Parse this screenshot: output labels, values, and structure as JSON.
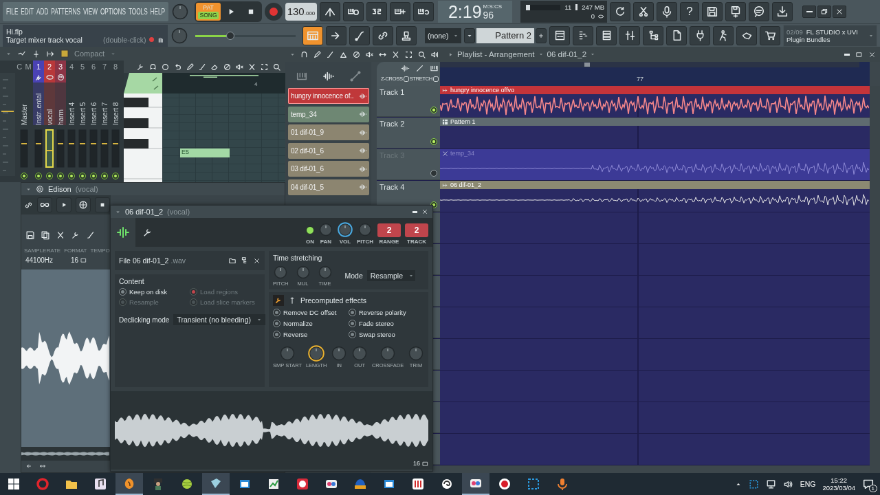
{
  "menu": [
    "FILE",
    "EDIT",
    "ADD",
    "PATTERNS",
    "VIEW",
    "OPTIONS",
    "TOOLS",
    "HELP"
  ],
  "transport": {
    "pat": "PAT",
    "song": "SONG",
    "song_selected": true,
    "record_armed": true,
    "tempo": "130",
    "tempo_decimals": ".000"
  },
  "time": {
    "main": "2:19",
    "unit": "M:S:CS",
    "centis": "96"
  },
  "monitor": {
    "voices": "11",
    "memory": "247 MB",
    "polyphony": "0"
  },
  "help": "?",
  "hint": {
    "file": "Hi.flp",
    "message": "Target mixer track  vocal",
    "action": "(double-click)"
  },
  "master_pitch": {
    "level": 0.35
  },
  "pattern_tools": [
    {
      "on": true
    },
    {
      "on": false
    },
    {
      "on": false
    },
    {
      "on": false
    },
    {
      "on": false
    }
  ],
  "pattern": {
    "picker": "(none)",
    "name": "Pattern 2"
  },
  "news": {
    "counter": "02/09",
    "title": "FL STUDIO x UVI",
    "subtitle": "Plugin Bundles"
  },
  "mixer": {
    "view": "Compact",
    "header": [
      "C",
      "M"
    ],
    "master": "Master",
    "inserts": [
      {
        "number": "1",
        "name": "Instr..ental",
        "color": "#4a42b4",
        "selected": false
      },
      {
        "number": "2",
        "name": "vocal",
        "color": "#b8383a",
        "selected": true
      },
      {
        "number": "3",
        "name": "harm",
        "color": "#8c3446",
        "selected": false
      },
      {
        "number": "4",
        "name": "Insert 4",
        "selected": false
      },
      {
        "number": "5",
        "name": "Insert 5",
        "selected": false
      },
      {
        "number": "6",
        "name": "Insert 6",
        "selected": false
      },
      {
        "number": "7",
        "name": "Insert 7",
        "selected": false
      },
      {
        "number": "8",
        "name": "Insert 8",
        "selected": false
      }
    ]
  },
  "piano_roll": {
    "bar": "4",
    "note": "E5"
  },
  "playlist": {
    "title": "Playlist - Arrangement",
    "clip": "06 dif-01_2",
    "bar": "77",
    "options": [
      {
        "label": "Z-CROSS",
        "checked": false
      },
      {
        "label": "STRETCH",
        "checked": false
      }
    ],
    "picker_tabs": [
      {
        "kind": "pattern",
        "selected": false
      },
      {
        "kind": "audio",
        "selected": true
      },
      {
        "kind": "automation",
        "selected": false
      }
    ],
    "picker_items": [
      {
        "name": "hungry innocence of..",
        "color": "#c0383a",
        "selected": true
      },
      {
        "name": "temp_34",
        "color": "#6e8773",
        "selected": false
      },
      {
        "name": "01 dif-01_9",
        "color": "#8c8570",
        "selected": false
      },
      {
        "name": "02 dif-01_6",
        "color": "#8c8570",
        "selected": false
      },
      {
        "name": "03 dif-01_6",
        "color": "#8c8570",
        "selected": false
      },
      {
        "name": "04 dif-01_5",
        "color": "#8c8570",
        "selected": false
      }
    ],
    "tracks": [
      {
        "name": "Track 1",
        "enabled": true,
        "clip": {
          "name": "hungry innocence offvo",
          "kind": "audio",
          "color": "#c4343a"
        }
      },
      {
        "name": "Track 2",
        "enabled": true,
        "clip": {
          "name": "Pattern 1",
          "kind": "pattern",
          "color": "#5f6b70"
        }
      },
      {
        "name": "Track 3",
        "enabled": false,
        "clip": {
          "name": "temp_34",
          "kind": "audio",
          "color": "#3c3a96"
        }
      },
      {
        "name": "Track 4",
        "enabled": true,
        "clip": {
          "name": "06 dif-01_2",
          "kind": "audio",
          "color": "#8c8a72"
        }
      }
    ]
  },
  "edison": {
    "title": "Edison",
    "source": "(vocal)",
    "labels": [
      "SAMPLERATE",
      "FORMAT",
      "TEMPO"
    ],
    "sample_rate": "44100",
    "unit": "Hz",
    "format": "16"
  },
  "sampler": {
    "title": "06 dif-01_2",
    "source": "(vocal)",
    "controls": [
      {
        "kind": "led",
        "label": "ON",
        "on": true
      },
      {
        "kind": "knob",
        "label": "PAN",
        "active": false
      },
      {
        "kind": "knob",
        "label": "VOL",
        "active": true
      },
      {
        "kind": "knob",
        "label": "PITCH",
        "active": false
      },
      {
        "kind": "box",
        "label": "RANGE",
        "value": "2"
      },
      {
        "kind": "box",
        "label": "TRACK",
        "value": "2"
      }
    ],
    "file": {
      "label": "File",
      "name": "06 dif-01_2",
      "ext": ".wav"
    },
    "content": {
      "title": "Content",
      "options": [
        {
          "label": "Keep on disk",
          "checked": false,
          "disabled": false
        },
        {
          "label": "Load regions",
          "checked": true,
          "disabled": true
        },
        {
          "label": "Resample",
          "checked": false,
          "disabled": true
        },
        {
          "label": "Load slice markers",
          "checked": false,
          "disabled": true
        }
      ],
      "declick_label": "Declicking mode",
      "declick_value": "Transient (no bleeding)"
    },
    "stretch": {
      "title": "Time stretching",
      "knobs": [
        "PITCH",
        "MUL",
        "TIME"
      ],
      "mode_label": "Mode",
      "mode": "Resample"
    },
    "effects": {
      "title": "Precomputed effects",
      "options": [
        {
          "label": "Remove DC offset",
          "checked": false
        },
        {
          "label": "Reverse polarity",
          "checked": false
        },
        {
          "label": "Normalize",
          "checked": false
        },
        {
          "label": "Fade stereo",
          "checked": false
        },
        {
          "label": "Reverse",
          "checked": false
        },
        {
          "label": "Swap stereo",
          "checked": false
        }
      ],
      "knobs": [
        {
          "label": "SMP START",
          "active": false
        },
        {
          "label": "LENGTH",
          "active": true
        },
        {
          "label": "IN",
          "active": false
        },
        {
          "label": "OUT",
          "active": false
        },
        {
          "label": "CROSSFADE",
          "active": false
        },
        {
          "label": "TRIM",
          "active": false
        }
      ]
    },
    "format": "16"
  },
  "taskbar": {
    "apps": [
      {
        "kind": "ring",
        "active": false
      },
      {
        "kind": "folder",
        "active": false
      },
      {
        "kind": "note",
        "active": false
      },
      {
        "kind": "fruit",
        "active": true
      },
      {
        "kind": "figure",
        "active": false
      },
      {
        "kind": "ball",
        "active": false
      },
      {
        "kind": "cube",
        "active": true
      },
      {
        "kind": "window",
        "active": false
      },
      {
        "kind": "chart",
        "active": false
      },
      {
        "kind": "badge",
        "active": false
      },
      {
        "kind": "toggle",
        "active": false
      },
      {
        "kind": "dome",
        "active": false
      },
      {
        "kind": "window",
        "active": false
      },
      {
        "kind": "bars",
        "active": false
      },
      {
        "kind": "swirl",
        "active": false
      },
      {
        "kind": "toggle",
        "active": true
      },
      {
        "kind": "record",
        "active": false
      },
      {
        "kind": "selection",
        "active": false
      },
      {
        "kind": "microphone",
        "active": false
      }
    ],
    "language": "ENG",
    "time": "15:22",
    "date": "2023/03/04",
    "notifications": "1"
  }
}
